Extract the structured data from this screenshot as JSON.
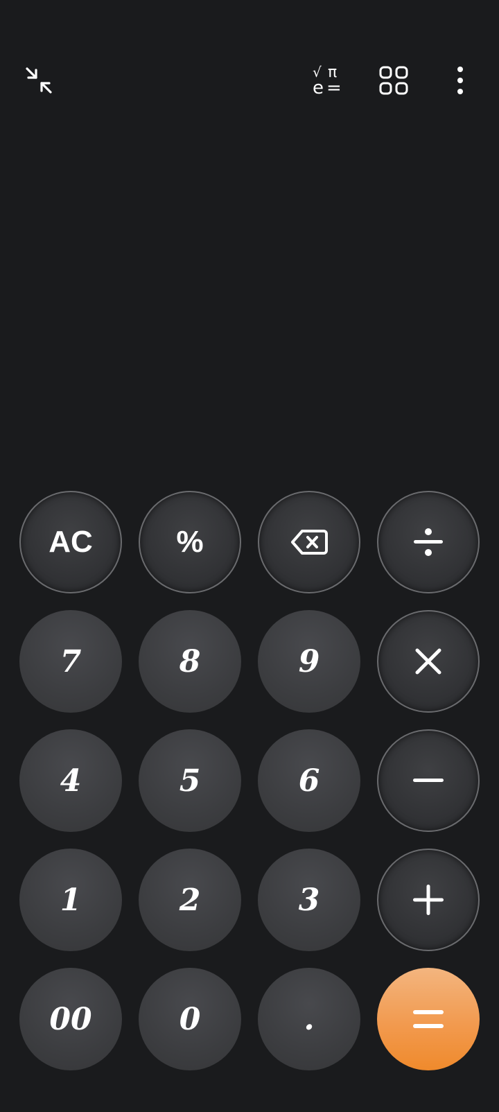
{
  "app": {
    "toolbar": {
      "collapse_icon": "collapse-arrows-icon",
      "scientific_icon": "scientific-mode-icon",
      "scientific_symbols": [
        "√",
        "π",
        "e",
        "="
      ],
      "converter_icon": "grid-icon",
      "more_icon": "more-vert-icon"
    },
    "display": {
      "expression": ""
    },
    "keypad": {
      "rows": [
        [
          "AC",
          "%",
          "backspace",
          "÷"
        ],
        [
          "7",
          "8",
          "9",
          "×"
        ],
        [
          "4",
          "5",
          "6",
          "−"
        ],
        [
          "1",
          "2",
          "3",
          "+"
        ],
        [
          "00",
          "0",
          ".",
          "="
        ]
      ],
      "labels": {
        "ac": "AC",
        "percent": "%",
        "seven": "7",
        "eight": "8",
        "nine": "9",
        "four": "4",
        "five": "5",
        "six": "6",
        "one": "1",
        "two": "2",
        "three": "3",
        "double_zero": "00",
        "zero": "0",
        "decimal": "."
      }
    },
    "colors": {
      "background": "#1a1b1d",
      "digit_key": "#3c3d40",
      "operator_key": "#2f3033",
      "equals_key": "#f29a4f",
      "text": "#ffffff"
    }
  }
}
